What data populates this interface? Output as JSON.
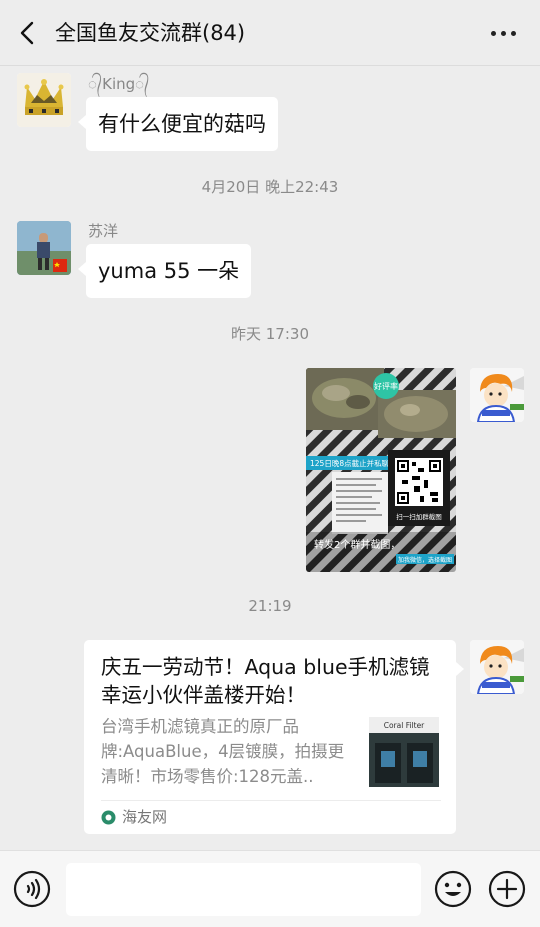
{
  "header": {
    "title": "全国鱼友交流群(84)",
    "back_icon": "chevron-left-icon",
    "more_icon": "more-dots-icon"
  },
  "messages": [
    {
      "side": "left",
      "sender": "᭄King᭄",
      "avatar_icon": "crown-avatar",
      "text": "有什么便宜的菇吗"
    },
    {
      "timestamp": "4月20日 晚上22:43"
    },
    {
      "side": "left",
      "sender": "苏洋",
      "avatar_icon": "photo-avatar",
      "text": "yuma 55 一朵"
    },
    {
      "timestamp": "昨天 17:30"
    },
    {
      "side": "right",
      "type": "image",
      "avatar_icon": "cartoon-avatar",
      "image_texts": {
        "badge": "好评率",
        "banner": "125日晚8点截止并私聊",
        "qr_caption": "扫一扫加群截图",
        "bottom": "转发2个群并截图，",
        "bottom_small": "加我微信，选择截图"
      }
    },
    {
      "timestamp": "21:19"
    },
    {
      "side": "right",
      "type": "link-card",
      "avatar_icon": "cartoon-avatar",
      "title": "庆五一劳动节！Aqua blue手机滤镜幸运小伙伴盖楼开始！",
      "description": "台湾手机滤镜真正的原厂品牌:AquaBlue，4层镀膜，拍摄更清晰！市场零售价:128元盖..",
      "thumb_label": "Coral Filter",
      "source": "海友网"
    }
  ],
  "input_bar": {
    "voice_icon": "voice-icon",
    "emoji_icon": "emoji-icon",
    "plus_icon": "plus-icon",
    "input_value": ""
  },
  "colors": {
    "background": "#ededed",
    "bubble": "#ffffff",
    "timestamp": "#8a8a8a"
  }
}
